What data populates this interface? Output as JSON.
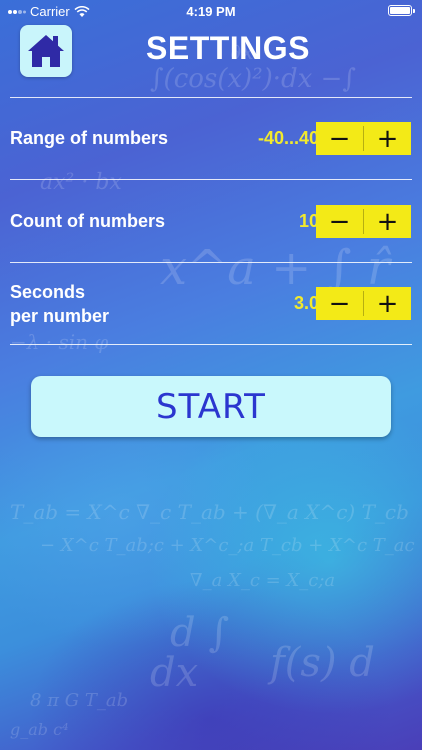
{
  "status_bar": {
    "carrier": "Carrier",
    "time": "4:19 PM"
  },
  "header": {
    "title": "SETTINGS",
    "home_icon": "home-icon"
  },
  "settings": [
    {
      "label": "Range of numbers",
      "value": "-40...40",
      "decrement": "−",
      "increment": "+"
    },
    {
      "label": "Count of numbers",
      "value": "10",
      "decrement": "−",
      "increment": "+"
    },
    {
      "label_line1": "Seconds",
      "label_line2": "per number",
      "value": "3.0",
      "decrement": "−",
      "increment": "+"
    }
  ],
  "start_label": "START",
  "colors": {
    "accent_yellow": "#f3ea17",
    "value_yellow": "#f2ea2d",
    "start_bg": "#c9f8fc",
    "start_text": "#2b36cf",
    "home_icon": "#2f2aa6"
  }
}
